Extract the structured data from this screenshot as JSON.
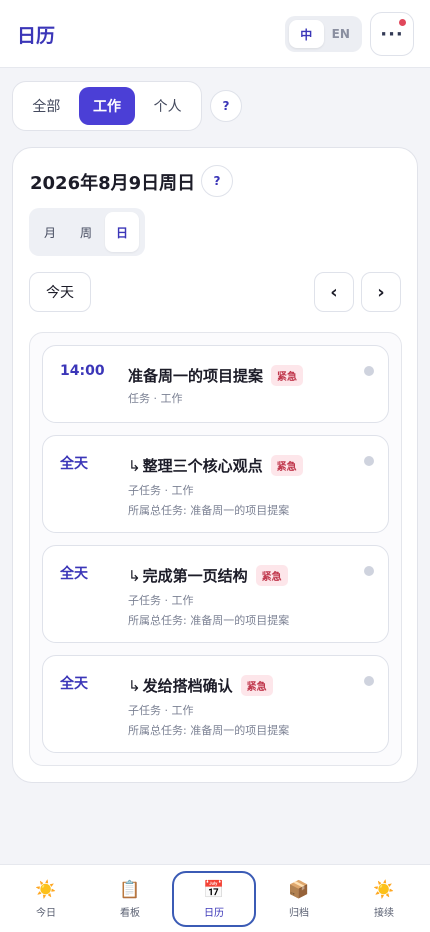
{
  "header": {
    "title": "日历",
    "lang_options": [
      "中",
      "EN"
    ],
    "lang_active": "中",
    "more_label": "···"
  },
  "filters": {
    "items": [
      "全部",
      "工作",
      "个人"
    ],
    "active": "工作",
    "help_label": "?"
  },
  "calendar": {
    "date_title": "2026年8月9日周日",
    "help_label": "?",
    "views": [
      "月",
      "周",
      "日"
    ],
    "active_view": "日",
    "today_label": "今天",
    "prev_label": "‹",
    "next_label": "›"
  },
  "events": [
    {
      "time": "14:00",
      "is_subtask": false,
      "title": "准备周一的项目提案",
      "badge": "紧急",
      "meta": "任务 · 工作",
      "parent": ""
    },
    {
      "time": "全天",
      "is_subtask": true,
      "title": "整理三个核心观点",
      "badge": "紧急",
      "meta": "子任务 · 工作",
      "parent": "所属总任务: 准备周一的项目提案"
    },
    {
      "time": "全天",
      "is_subtask": true,
      "title": "完成第一页结构",
      "badge": "紧急",
      "meta": "子任务 · 工作",
      "parent": "所属总任务: 准备周一的项目提案"
    },
    {
      "time": "全天",
      "is_subtask": true,
      "title": "发给搭档确认",
      "badge": "紧急",
      "meta": "子任务 · 工作",
      "parent": "所属总任务: 准备周一的项目提案"
    }
  ],
  "subtask_arrow": "↳",
  "bottom_nav": [
    {
      "label": "今日",
      "icon": "☀️",
      "icon_name": "sun-icon"
    },
    {
      "label": "看板",
      "icon": "📋",
      "icon_name": "clipboard-icon"
    },
    {
      "label": "日历",
      "icon": "📅",
      "icon_name": "calendar-icon"
    },
    {
      "label": "归档",
      "icon": "📦",
      "icon_name": "archive-box-icon"
    },
    {
      "label": "接续",
      "icon": "☀️",
      "icon_name": "sun-icon"
    }
  ],
  "bottom_nav_active": "日历",
  "colors": {
    "accent": "#4b3fd6",
    "title": "#3b36b8",
    "urgent_text": "#c0384d",
    "urgent_bg": "#fde6ea",
    "notification": "#e0475b"
  }
}
